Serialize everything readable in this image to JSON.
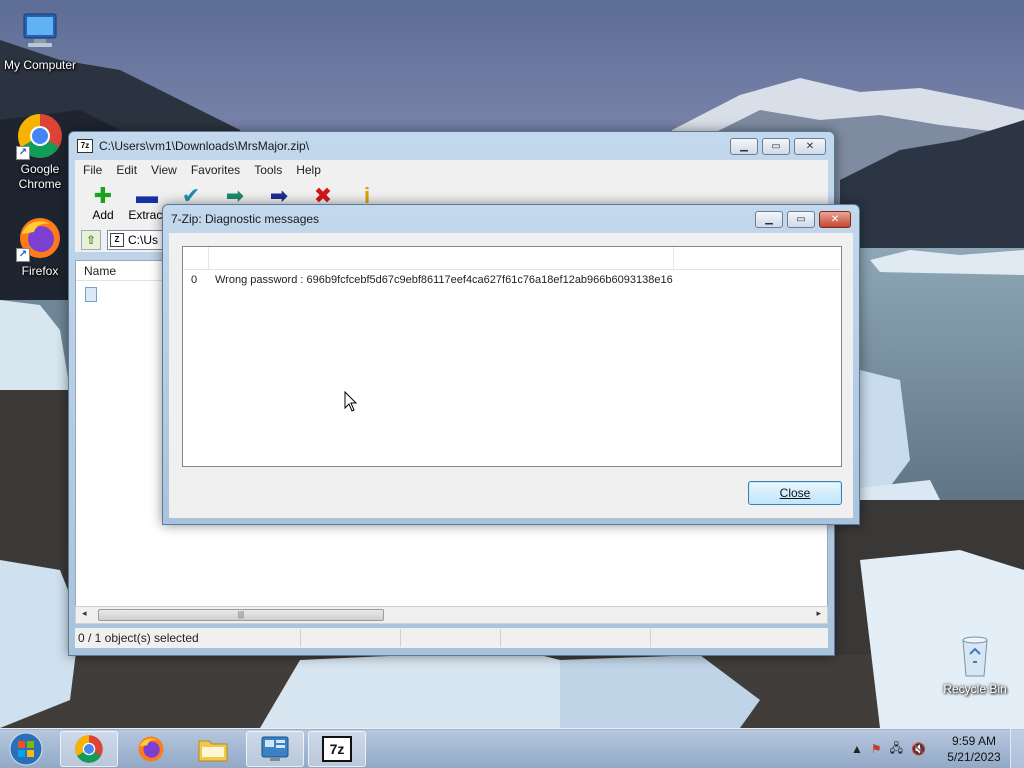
{
  "desktop": {
    "icons": [
      {
        "label": "My Computer"
      },
      {
        "label": "Google Chrome"
      },
      {
        "label": "Firefox"
      },
      {
        "label": "Recycle Bin"
      }
    ]
  },
  "main_window": {
    "title": "C:\\Users\\vm1\\Downloads\\MrsMajor.zip\\",
    "menu": [
      "File",
      "Edit",
      "View",
      "Favorites",
      "Tools",
      "Help"
    ],
    "toolbar": [
      {
        "label": "Add",
        "icon": "plus-icon",
        "color": "#1aa31a"
      },
      {
        "label": "Extract",
        "icon": "minus-icon",
        "color": "#1630a8"
      }
    ],
    "address": "C:\\Us",
    "list_header": "Name",
    "status": "0 / 1 object(s) selected"
  },
  "dialog": {
    "title": "7-Zip: Diagnostic messages",
    "messages": [
      {
        "index": "0",
        "text": "Wrong password : 696b9fcfcebf5d67c9ebf86117eef4ca627f61c76a18ef12ab966b6093138e16"
      }
    ],
    "close_label": "Close"
  },
  "taskbar": {
    "time": "9:59 AM",
    "date": "5/21/2023",
    "tasks": [
      "chrome",
      "firefox",
      "explorer",
      "control-panel",
      "7-zip"
    ]
  },
  "colors": {
    "titlebar": "#b9d1ea",
    "close_button": "#c4452f",
    "button_focus": "#3c7fb1"
  }
}
